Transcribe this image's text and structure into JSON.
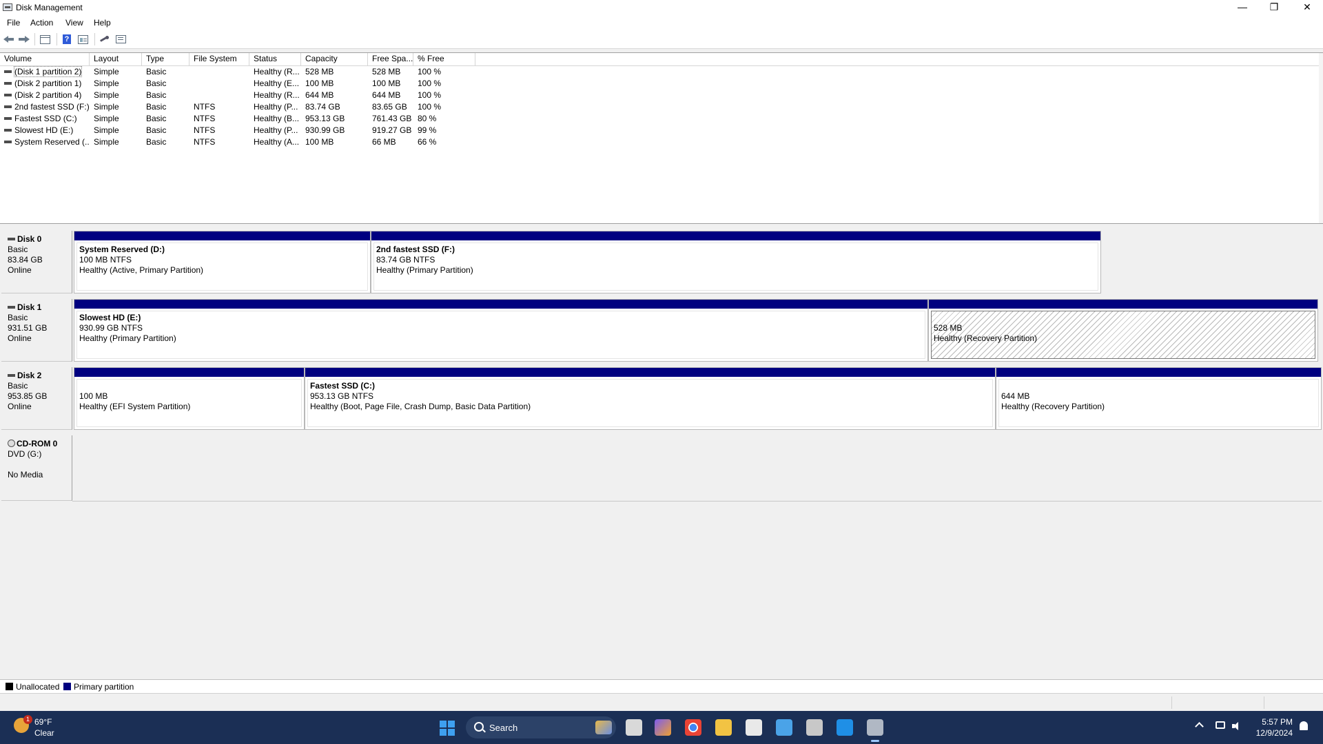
{
  "window": {
    "title": "Disk Management",
    "minimize": "—",
    "maximize": "❐",
    "close": "✕"
  },
  "menu": [
    "File",
    "Action",
    "View",
    "Help"
  ],
  "toolbar": {
    "help_glyph": "?"
  },
  "volume_list": {
    "columns": [
      "Volume",
      "Layout",
      "Type",
      "File System",
      "Status",
      "Capacity",
      "Free Spa...",
      "% Free"
    ],
    "rows": [
      [
        "(Disk 1 partition 2)",
        "Simple",
        "Basic",
        "",
        "Healthy (R...",
        "528 MB",
        "528 MB",
        "100 %"
      ],
      [
        "(Disk 2 partition 1)",
        "Simple",
        "Basic",
        "",
        "Healthy (E...",
        "100 MB",
        "100 MB",
        "100 %"
      ],
      [
        "(Disk 2 partition 4)",
        "Simple",
        "Basic",
        "",
        "Healthy (R...",
        "644 MB",
        "644 MB",
        "100 %"
      ],
      [
        "2nd fastest SSD (F:)",
        "Simple",
        "Basic",
        "NTFS",
        "Healthy (P...",
        "83.74 GB",
        "83.65 GB",
        "100 %"
      ],
      [
        "Fastest SSD (C:)",
        "Simple",
        "Basic",
        "NTFS",
        "Healthy (B...",
        "953.13 GB",
        "761.43 GB",
        "80 %"
      ],
      [
        "Slowest HD (E:)",
        "Simple",
        "Basic",
        "NTFS",
        "Healthy (P...",
        "930.99 GB",
        "919.27 GB",
        "99 %"
      ],
      [
        "System Reserved (...",
        "Simple",
        "Basic",
        "NTFS",
        "Healthy (A...",
        "100 MB",
        "66 MB",
        "66 %"
      ]
    ]
  },
  "disks": [
    {
      "name": "Disk 0",
      "type": "Basic",
      "size": "83.84 GB",
      "status": "Online",
      "partitions": [
        {
          "name": "System Reserved  (D:)",
          "size": "100 MB NTFS",
          "status": "Healthy (Active, Primary Partition)"
        },
        {
          "name": "2nd fastest SSD  (F:)",
          "size": "83.74 GB NTFS",
          "status": "Healthy (Primary Partition)"
        }
      ]
    },
    {
      "name": "Disk 1",
      "type": "Basic",
      "size": "931.51 GB",
      "status": "Online",
      "partitions": [
        {
          "name": "Slowest HD  (E:)",
          "size": "930.99 GB NTFS",
          "status": "Healthy (Primary Partition)"
        },
        {
          "name": "",
          "size": "528 MB",
          "status": "Healthy (Recovery Partition)"
        }
      ]
    },
    {
      "name": "Disk 2",
      "type": "Basic",
      "size": "953.85 GB",
      "status": "Online",
      "partitions": [
        {
          "name": "",
          "size": "100 MB",
          "status": "Healthy (EFI System Partition)"
        },
        {
          "name": "Fastest SSD  (C:)",
          "size": "953.13 GB NTFS",
          "status": "Healthy (Boot, Page File, Crash Dump, Basic Data Partition)"
        },
        {
          "name": "",
          "size": "644 MB",
          "status": "Healthy (Recovery Partition)"
        }
      ]
    }
  ],
  "cdrom": {
    "name": "CD-ROM 0",
    "drive": "DVD (G:)",
    "status": "No Media"
  },
  "legend": {
    "unallocated": "Unallocated",
    "primary": "Primary partition",
    "unallocated_color": "#000000",
    "primary_color": "#000080"
  },
  "taskbar": {
    "weather_temp": "69°F",
    "weather_desc": "Clear",
    "weather_badge": "1",
    "search_label": "Search",
    "time": "5:57 PM",
    "date": "12/9/2024"
  }
}
